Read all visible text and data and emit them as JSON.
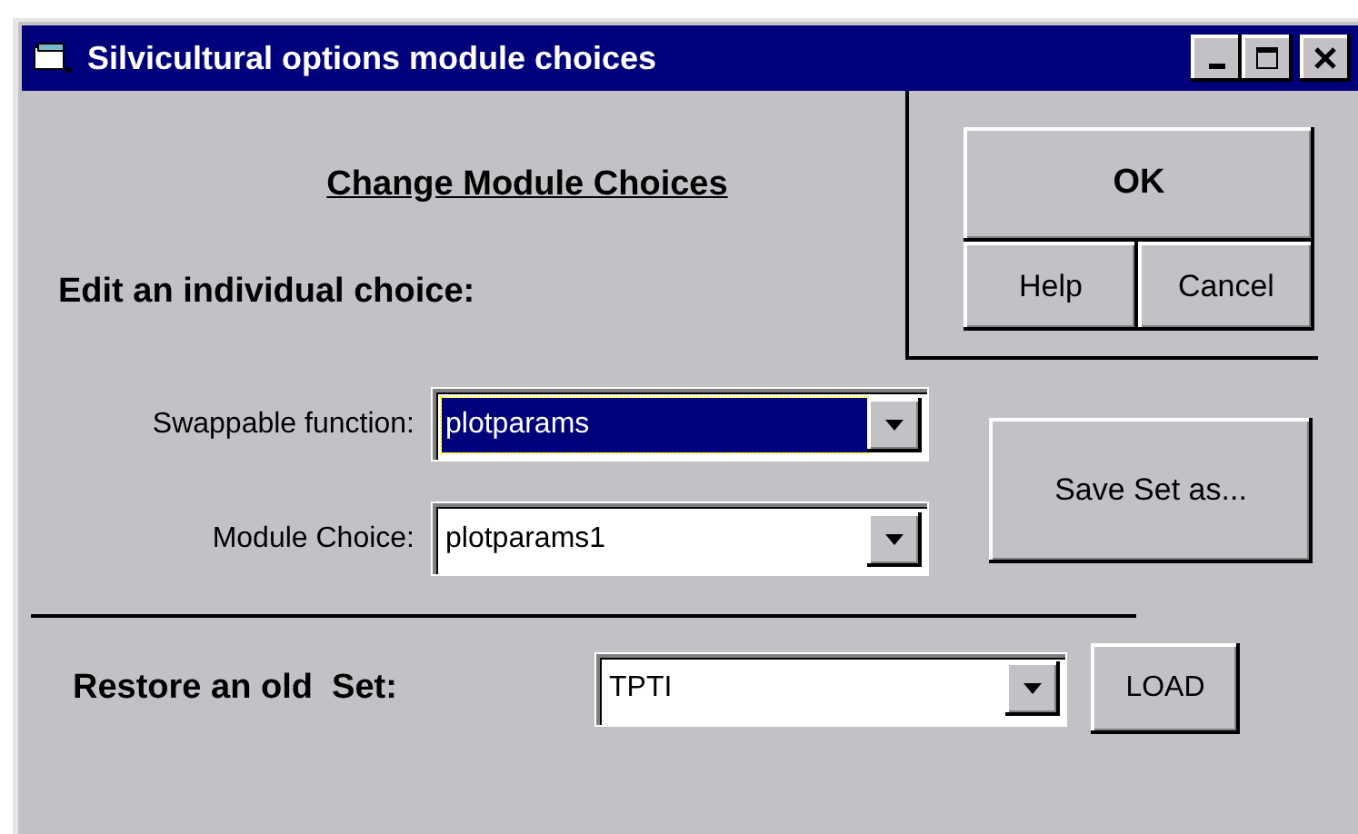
{
  "window": {
    "title": "Silvicultural options module choices"
  },
  "heading": "Change Module Choices",
  "section_label": "Edit an individual choice:",
  "dialog_buttons": {
    "ok": "OK",
    "help": "Help",
    "cancel": "Cancel"
  },
  "fields": [
    {
      "label": "Swappable function:",
      "value": "plotparams",
      "focused": true
    },
    {
      "label": "Module Choice:",
      "value": "plotparams1",
      "focused": false
    }
  ],
  "save_button": "Save Set as...",
  "restore": {
    "label": "Restore an old  Set:",
    "value": "TPTI",
    "button": "LOAD"
  }
}
